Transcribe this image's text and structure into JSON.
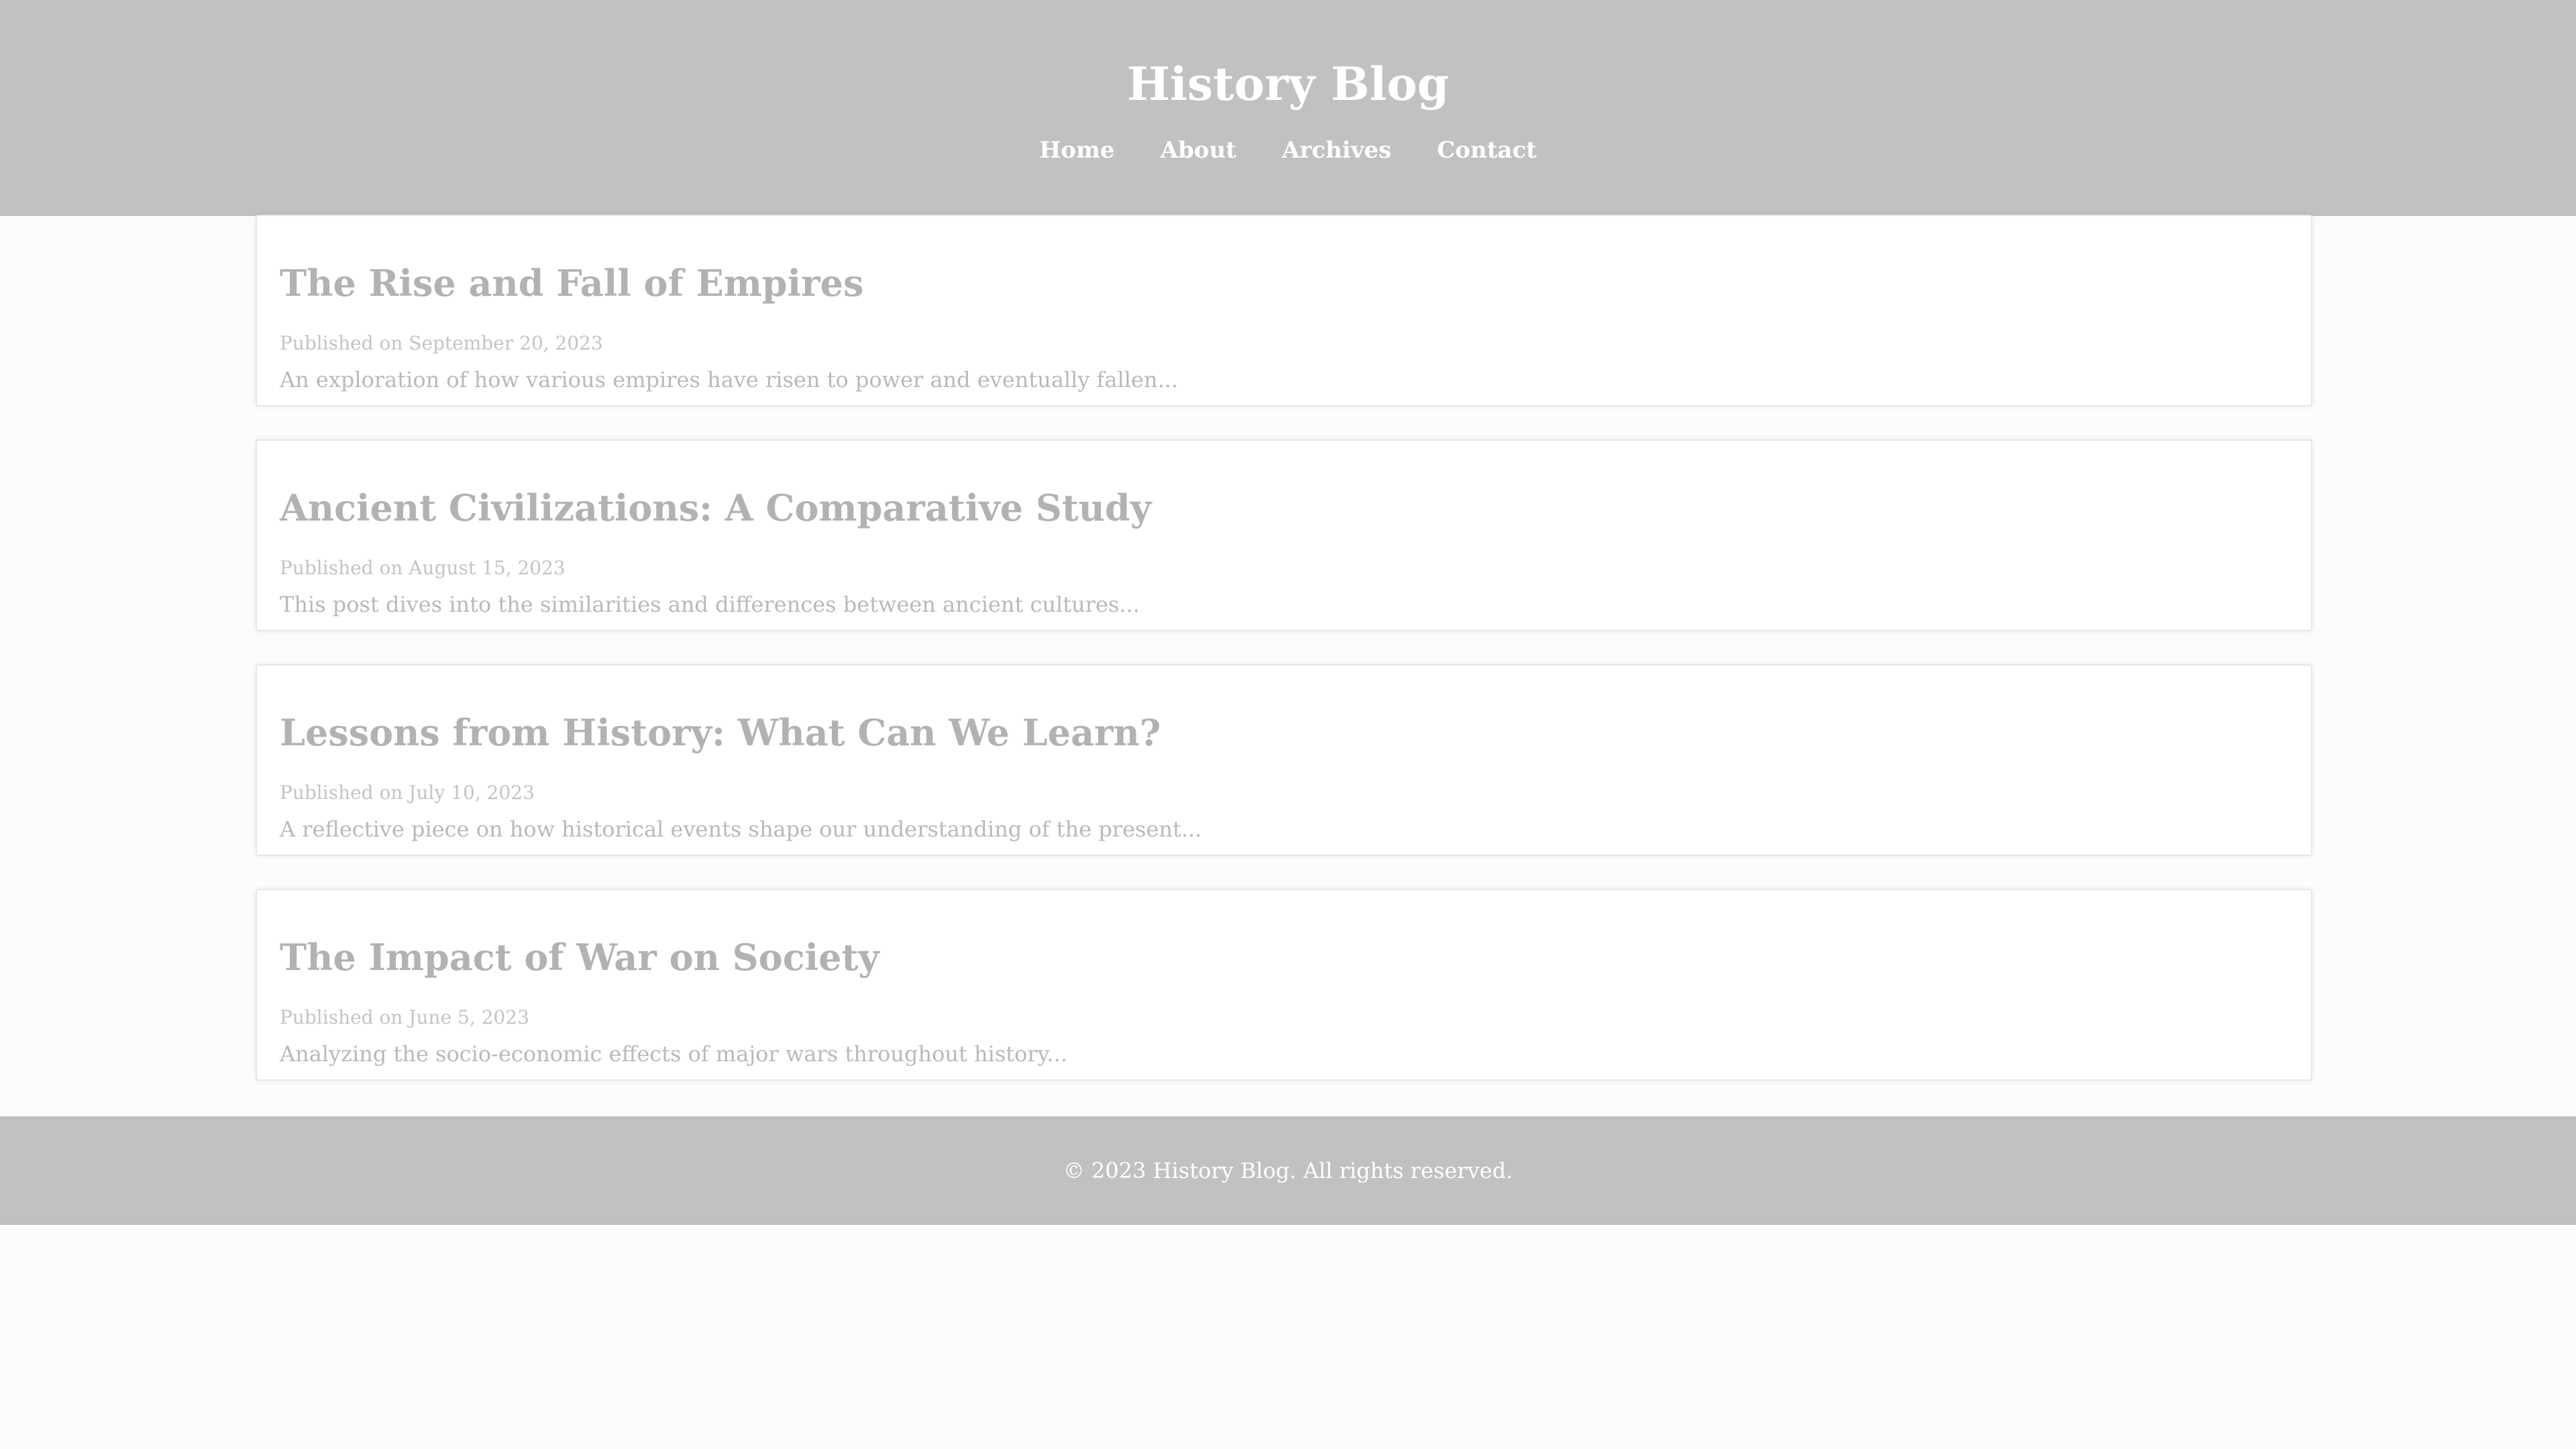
{
  "header": {
    "title": "History Blog",
    "nav": [
      "Home",
      "About",
      "Archives",
      "Contact"
    ]
  },
  "posts": [
    {
      "title": "The Rise and Fall of Empires",
      "date": "Published on September 20, 2023",
      "excerpt": "An exploration of how various empires have risen to power and eventually fallen..."
    },
    {
      "title": "Ancient Civilizations: A Comparative Study",
      "date": "Published on August 15, 2023",
      "excerpt": "This post dives into the similarities and differences between ancient cultures..."
    },
    {
      "title": "Lessons from History: What Can We Learn?",
      "date": "Published on July 10, 2023",
      "excerpt": "A reflective piece on how historical events shape our understanding of the present..."
    },
    {
      "title": "The Impact of War on Society",
      "date": "Published on June 5, 2023",
      "excerpt": "Analyzing the socio-economic effects of major wars throughout history..."
    }
  ],
  "footer": {
    "text": "© 2023 History Blog. All rights reserved."
  }
}
